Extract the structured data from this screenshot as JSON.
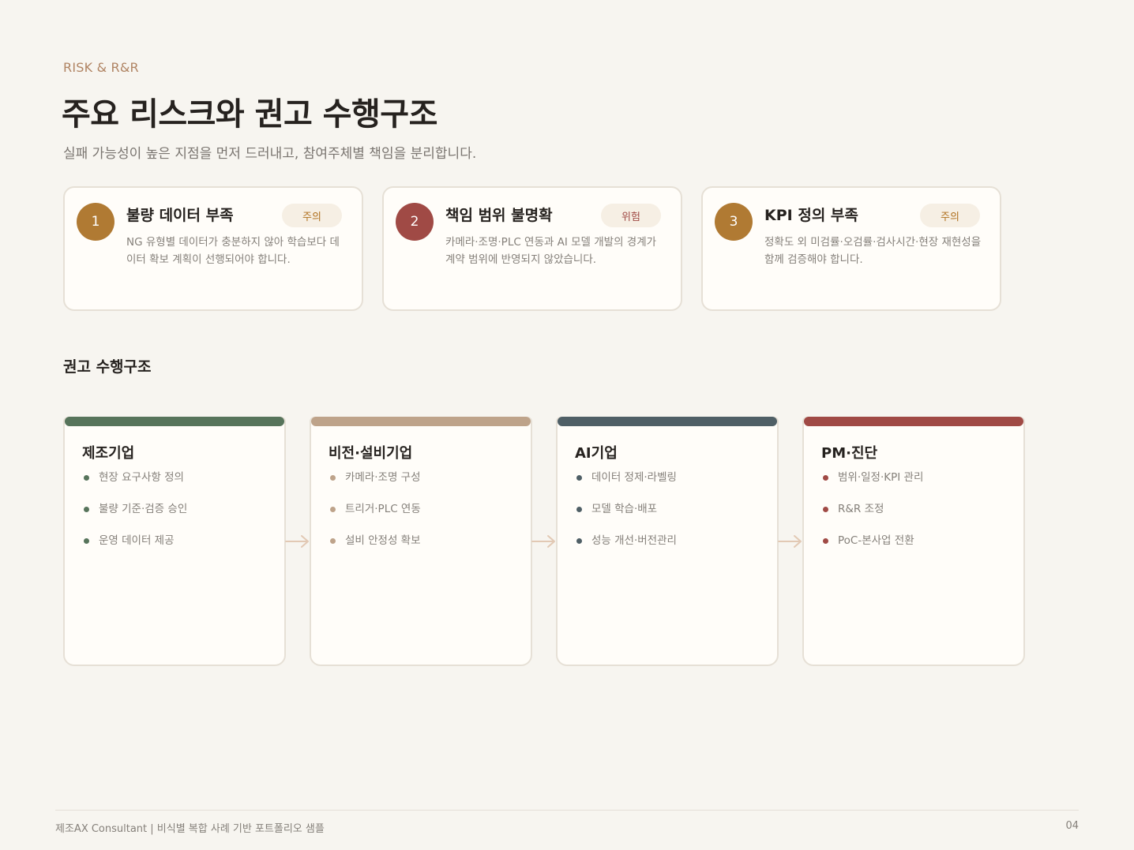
{
  "header": {
    "eyebrow": "RISK & R&R",
    "title": "주요 리스크와 권고 수행구조",
    "subtitle": "실패 가능성이 높은 지점을 먼저 드러내고, 참여주체별 책임을 분리합니다."
  },
  "risks": [
    {
      "num": "1",
      "title": "불량 데이터 부족",
      "badge": "주의",
      "desc": "NG 유형별 데이터가 충분하지 않아 학습보다 데이터 확보 계획이 선행되어야 합니다.",
      "num_color": "#b07a33",
      "badge_color": "#b0711f"
    },
    {
      "num": "2",
      "title": "책임 범위 불명확",
      "badge": "위험",
      "desc": "카메라·조명·PLC 연동과 AI 모델 개발의 경계가 계약 범위에 반영되지 않았습니다.",
      "num_color": "#a04a45",
      "badge_color": "#a04a45"
    },
    {
      "num": "3",
      "title": "KPI 정의 부족",
      "badge": "주의",
      "desc": "정확도 외 미검률·오검률·검사시간·현장 재현성을 함께 검증해야 합니다.",
      "num_color": "#b07a33",
      "badge_color": "#b0711f"
    }
  ],
  "structure": {
    "heading": "권고 수행구조",
    "columns": [
      {
        "title": "제조기업",
        "color": "#57745b",
        "items": [
          "현장 요구사항 정의",
          "불량 기준·검증 승인",
          "운영 데이터 제공"
        ]
      },
      {
        "title": "비전·설비기업",
        "color": "#bea38a",
        "items": [
          "카메라·조명 구성",
          "트리거·PLC 연동",
          "설비 안정성 확보"
        ]
      },
      {
        "title": "AI기업",
        "color": "#4f5f66",
        "items": [
          "데이터 정제·라벨링",
          "모델 학습·배포",
          "성능 개선·버전관리"
        ]
      },
      {
        "title": "PM·진단",
        "color": "#a04a45",
        "items": [
          "범위·일정·KPI 관리",
          "R&R 조정",
          "PoC-본사업 전환"
        ]
      }
    ]
  },
  "footer": {
    "left": "제조AX Consultant | 비식별 복합 사례 기반 포트폴리오 샘플",
    "page": "04"
  }
}
